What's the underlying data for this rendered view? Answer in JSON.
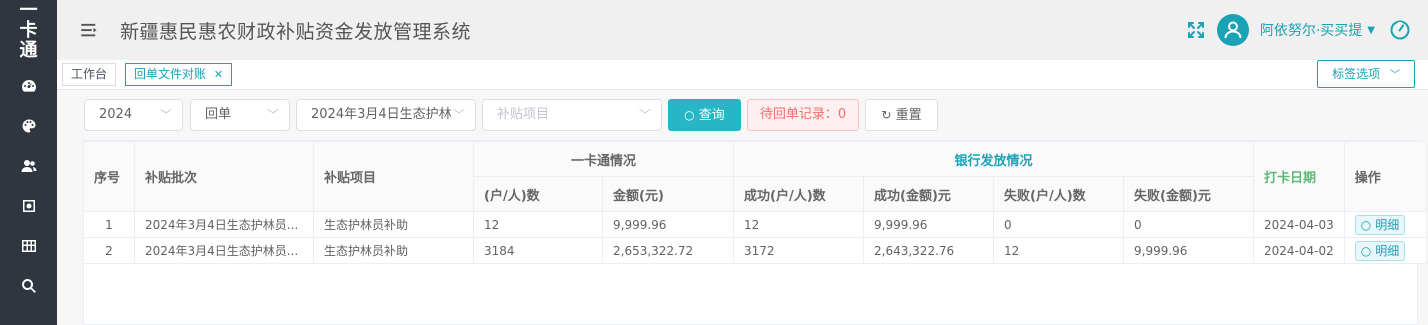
{
  "sidebar": {
    "logo": [
      "一",
      "卡",
      "通"
    ],
    "items": [
      {
        "icon": "dashboard-icon"
      },
      {
        "icon": "palette-icon"
      },
      {
        "icon": "users-icon"
      },
      {
        "icon": "settings-box-icon"
      },
      {
        "icon": "grid-icon"
      },
      {
        "icon": "search-icon"
      }
    ]
  },
  "header": {
    "title": "新疆惠民惠农财政补贴资金发放管理系统",
    "username": "阿依努尔·买买提"
  },
  "tags": {
    "items": [
      {
        "label": "工作台"
      },
      {
        "label": "回单文件对账",
        "active": true
      }
    ],
    "options_label": "标签选项"
  },
  "filters": {
    "year": "2024",
    "type": "回单",
    "batch": "2024年3月4日生态护林",
    "project_placeholder": "补贴项目",
    "query_label": "查询",
    "pending_label": "待回单记录：0",
    "reset_label": "重置"
  },
  "table": {
    "headers": {
      "index": "序号",
      "batch": "补贴批次",
      "project": "补贴项目",
      "card_group": "一卡通情况",
      "card_count": "(户/人)数",
      "card_amount": "金额(元)",
      "bank_group": "银行发放情况",
      "success_count": "成功(户/人)数",
      "success_amount": "成功(金额)元",
      "fail_count": "失败(户/人)数",
      "fail_amount": "失败(金额)元",
      "date": "打卡日期",
      "action": "操作"
    },
    "rows": [
      {
        "index": "1",
        "batch": "2024年3月4日生态护林员...",
        "project": "生态护林员补助",
        "card_count": "12",
        "card_amount": "9,999.96",
        "success_count": "12",
        "success_amount": "9,999.96",
        "fail_count": "0",
        "fail_amount": "0",
        "date": "2024-04-03",
        "action": "明细"
      },
      {
        "index": "2",
        "batch": "2024年3月4日生态护林员...",
        "project": "生态护林员补助",
        "card_count": "3184",
        "card_amount": "2,653,322.72",
        "success_count": "3172",
        "success_amount": "2,643,322.76",
        "fail_count": "12",
        "fail_amount": "9,999.96",
        "date": "2024-04-02",
        "action": "明细"
      }
    ]
  },
  "colors": {
    "accent": "#1aa3b5",
    "sidebar": "#2f3640",
    "pending": "#f56c6c"
  }
}
